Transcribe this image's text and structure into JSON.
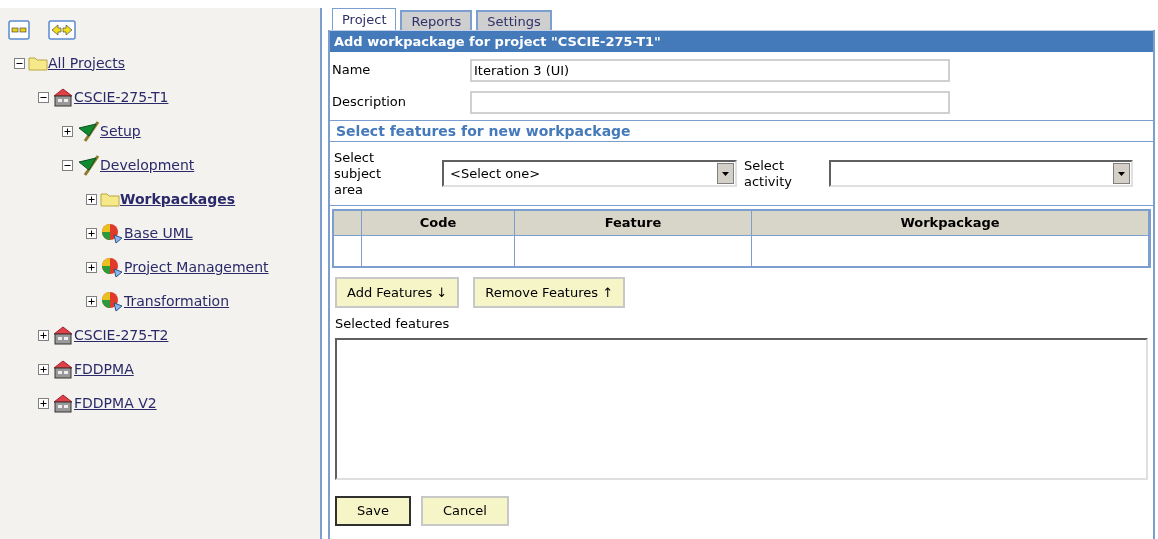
{
  "toolbar": {
    "buttons": [
      {
        "kind": "collapse"
      },
      {
        "kind": "swap"
      }
    ]
  },
  "tree": [
    {
      "label": "All Projects",
      "kind": "folder",
      "expanded": true,
      "selected": false,
      "children": [
        {
          "label": "CSCIE-275-T1",
          "kind": "house",
          "expanded": true,
          "selected": false,
          "children": [
            {
              "label": "Setup",
              "kind": "flag",
              "expanded": false,
              "selected": false
            },
            {
              "label": "Development",
              "kind": "flag",
              "expanded": true,
              "selected": false,
              "children": [
                {
                  "label": "Workpackages",
                  "kind": "folder",
                  "expanded": false,
                  "selected": true
                },
                {
                  "label": "Base UML",
                  "kind": "pie",
                  "expanded": false,
                  "selected": false
                },
                {
                  "label": "Project Management",
                  "kind": "pie",
                  "expanded": false,
                  "selected": false
                },
                {
                  "label": "Transformation",
                  "kind": "pie",
                  "expanded": false,
                  "selected": false
                }
              ]
            }
          ]
        },
        {
          "label": "CSCIE-275-T2",
          "kind": "house",
          "expanded": false,
          "selected": false
        },
        {
          "label": "FDDPMA",
          "kind": "house",
          "expanded": false,
          "selected": false
        },
        {
          "label": "FDDPMA V2",
          "kind": "house",
          "expanded": false,
          "selected": false
        }
      ]
    }
  ],
  "tabs": [
    {
      "label": "Project",
      "selected": true
    },
    {
      "label": "Reports",
      "selected": false
    },
    {
      "label": "Settings",
      "selected": false
    }
  ],
  "form": {
    "title": "Add workpackage for project \"CSCIE-275-T1\"",
    "name": {
      "label": "Name",
      "value": "Iteration 3 (UI)"
    },
    "description": {
      "label": "Description"
    },
    "section_title": "Select features for new workpackage",
    "subject_area": {
      "label": "Select subject area",
      "value": "<Select one>"
    },
    "activity": {
      "label": "Select activity"
    },
    "table": {
      "columns": [
        "Code",
        "Feature",
        "Workpackage"
      ]
    },
    "add_button": "Add Features ↓",
    "remove_button": "Remove Features ↑",
    "selected_label": "Selected features",
    "buttons": [
      {
        "label": "Save",
        "default": true
      },
      {
        "label": "Cancel",
        "default": false
      }
    ]
  }
}
